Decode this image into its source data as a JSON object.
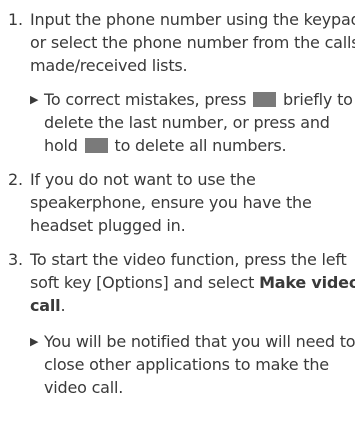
{
  "steps": [
    {
      "number": "1.",
      "lines": [
        "Input the phone number using the keypad,",
        "or select the phone number from the calls",
        "made/received lists."
      ]
    },
    {
      "number": "2.",
      "lines": [
        "If you do not want to use the",
        "speakerphone, ensure you have the",
        "headset plugged in."
      ]
    },
    {
      "number": "3.",
      "line1": "To start the video function, press the left",
      "line2_pre": "soft key [Options] and select ",
      "line2_bold": "Make video",
      "line3_bold": "call",
      "line3_post": "."
    }
  ],
  "bullets": [
    {
      "arrow": "▶",
      "line1_pre": "To correct mistakes, press ",
      "line1_post": " briefly to",
      "line2": "delete the last number, or press and",
      "line3_pre": "hold ",
      "line3_post": " to delete all numbers."
    },
    {
      "arrow": "▶",
      "lines": [
        "You will be notified that you will need to",
        "close other applications to make the",
        "video call."
      ]
    }
  ],
  "icons": {
    "clear_key": "clear-key-icon",
    "clear_key_color": "#7a7a7a"
  }
}
